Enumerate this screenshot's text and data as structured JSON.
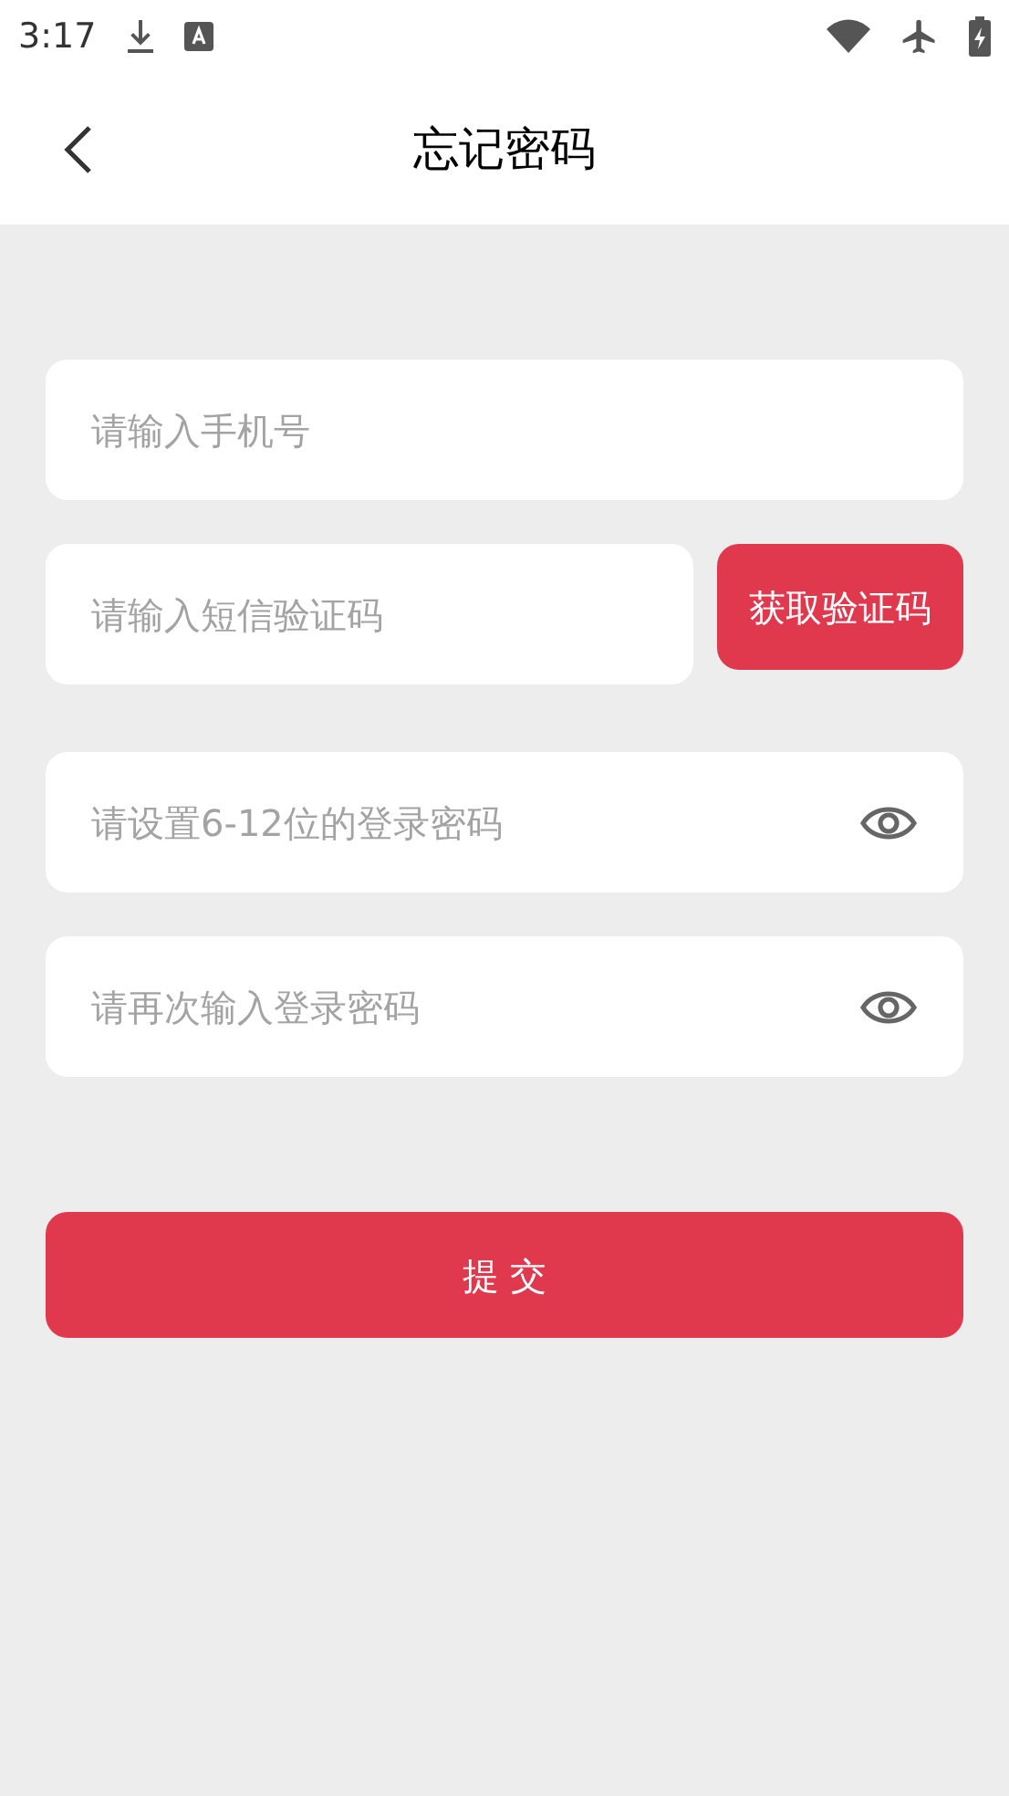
{
  "status_bar": {
    "time": "3:17"
  },
  "header": {
    "title": "忘记密码"
  },
  "phone_field": {
    "placeholder": "请输入手机号"
  },
  "code_field": {
    "placeholder": "请输入短信验证码"
  },
  "get_code_button": {
    "label": "获取验证码"
  },
  "password_fields": [
    {
      "placeholder": "请设置6-12位的登录密码"
    },
    {
      "placeholder": "请再次输入登录密码"
    }
  ],
  "submit_button": {
    "label": "提 交"
  }
}
